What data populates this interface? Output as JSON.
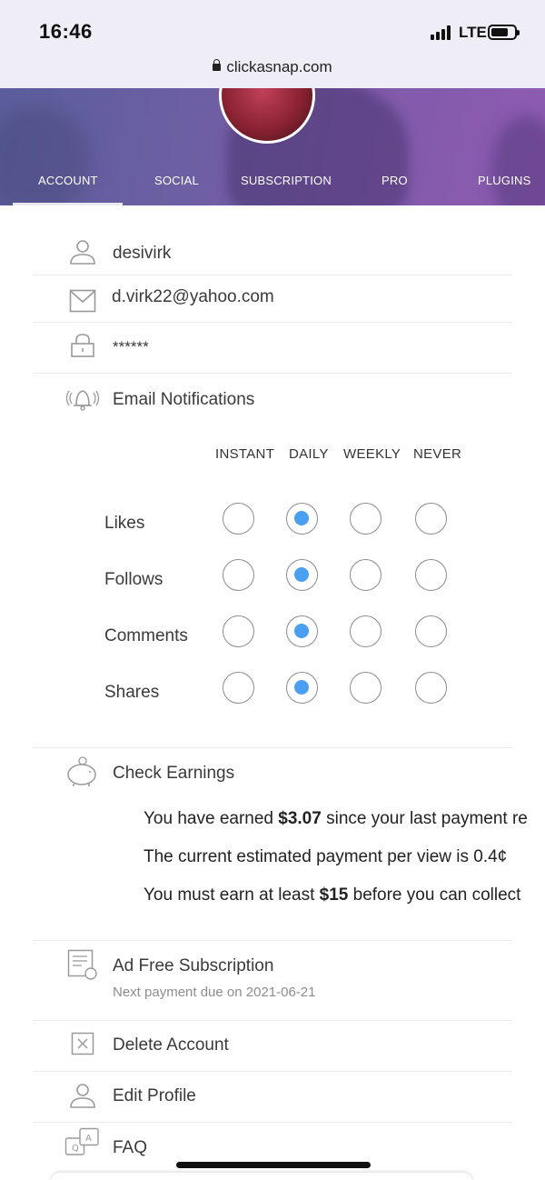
{
  "status_bar": {
    "time": "16:46",
    "network": "LTE"
  },
  "browser": {
    "url": "clickasnap.com"
  },
  "tabs": [
    {
      "label": "ACCOUNT",
      "active": true
    },
    {
      "label": "SOCIAL",
      "active": false
    },
    {
      "label": "SUBSCRIPTION",
      "active": false
    },
    {
      "label": "PRO",
      "active": false
    },
    {
      "label": "PLUGINS",
      "active": false
    }
  ],
  "account": {
    "username": "desivirk",
    "email": "d.virk22@yahoo.com",
    "password": "******"
  },
  "email_notifications": {
    "title": "Email Notifications",
    "columns": [
      "INSTANT",
      "DAILY",
      "WEEKLY",
      "NEVER"
    ],
    "rows": [
      {
        "label": "Likes",
        "selected": "DAILY"
      },
      {
        "label": "Follows",
        "selected": "DAILY"
      },
      {
        "label": "Comments",
        "selected": "DAILY"
      },
      {
        "label": "Shares",
        "selected": "DAILY"
      }
    ]
  },
  "earnings": {
    "title": "Check Earnings",
    "line1_pre": "You have earned ",
    "line1_amount": "$3.07",
    "line1_post": " since your last payment re",
    "line2": "The current estimated payment per view is 0.4¢",
    "line3_pre": "You must earn at least ",
    "line3_amount": "$15",
    "line3_post": " before you can collect"
  },
  "subscription": {
    "title": "Ad Free Subscription",
    "note": "Next payment due on 2021-06-21"
  },
  "menu": {
    "delete_account": "Delete Account",
    "edit_profile": "Edit Profile",
    "faq": "FAQ"
  },
  "colors": {
    "accent": "#4a9ff0",
    "header_start": "#5a5e9a",
    "header_end": "#8e5bb2"
  },
  "icons": [
    "user-icon",
    "mail-icon",
    "lock-icon",
    "bell-icon",
    "piggy-bank-icon",
    "receipt-icon",
    "delete-box-icon",
    "user-icon",
    "faq-icon"
  ]
}
